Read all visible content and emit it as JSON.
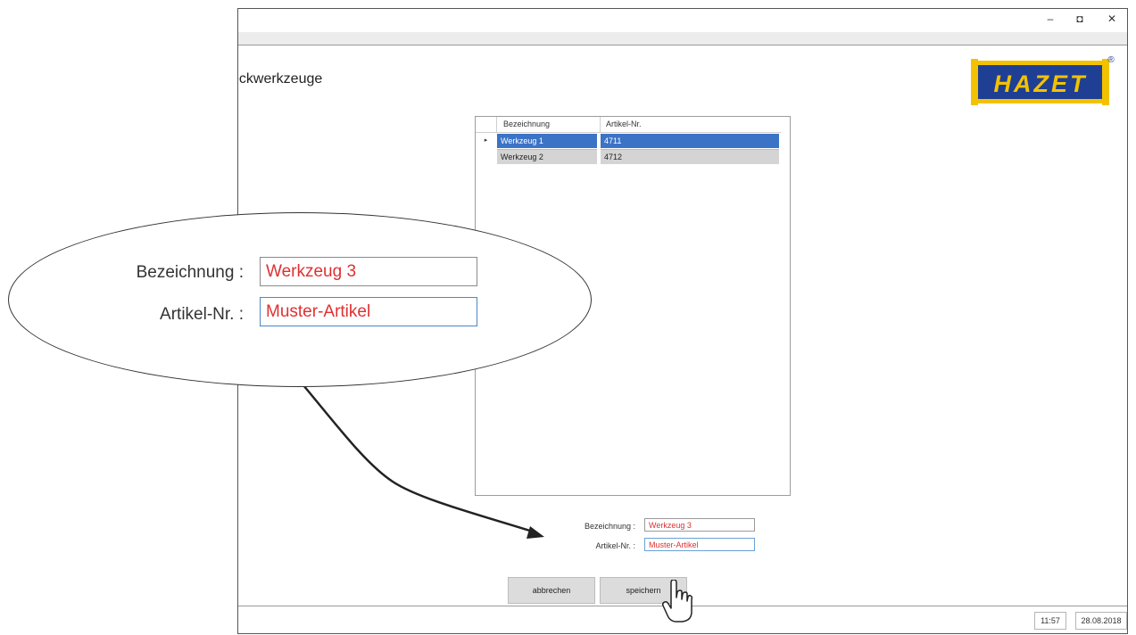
{
  "window": {
    "controls": {
      "minimize": "–",
      "maximize": "◘",
      "close": "✕"
    }
  },
  "form_title": "eckwerkzeuge",
  "logo": {
    "text": "HAZET",
    "registered": "®",
    "colors": {
      "background": "#1f3f95",
      "accent": "#f2c200"
    }
  },
  "grid": {
    "headers": [
      "Bezeichnung",
      "Artikel-Nr."
    ],
    "rows": [
      {
        "selector": "▸",
        "bezeichnung": "Werkzeug 1",
        "artikel": "4711",
        "selected": true
      },
      {
        "selector": "",
        "bezeichnung": "Werkzeug 2",
        "artikel": "4712",
        "selected": false
      }
    ]
  },
  "form": {
    "bezeichnung_label": "Bezeichnung :",
    "bezeichnung_value": "Werkzeug 3",
    "artikel_label": "Artikel-Nr. :",
    "artikel_value": "Muster-Artikel"
  },
  "callout": {
    "bezeichnung_label": "Bezeichnung :",
    "bezeichnung_value": "Werkzeug 3",
    "artikel_label": "Artikel-Nr. :",
    "artikel_value": "Muster-Artikel"
  },
  "buttons": {
    "cancel": "abbrechen",
    "save": "speichern"
  },
  "status": {
    "time": "11:57",
    "date": "28.08.2018"
  },
  "colors": {
    "selection": "#3b73c6",
    "input_text": "#e03030"
  }
}
